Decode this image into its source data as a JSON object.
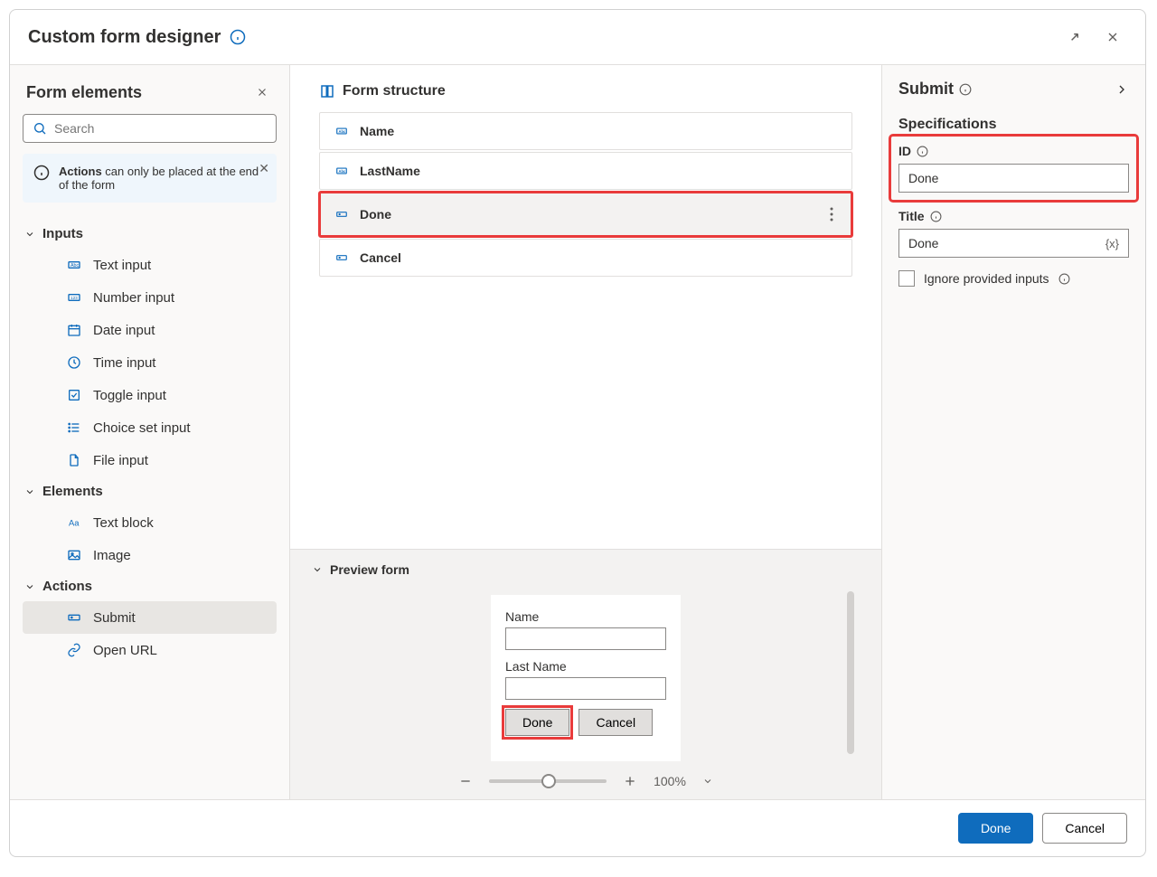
{
  "title": "Custom form designer",
  "left": {
    "heading": "Form elements",
    "search_placeholder": "Search",
    "info_prefix": "Actions",
    "info_text": " can only be placed at the end of the form",
    "groups": {
      "inputs": "Inputs",
      "elements": "Elements",
      "actions": "Actions"
    },
    "items": {
      "text_input": "Text input",
      "number_input": "Number input",
      "date_input": "Date input",
      "time_input": "Time input",
      "toggle_input": "Toggle input",
      "choice_set_input": "Choice set input",
      "file_input": "File input",
      "text_block": "Text block",
      "image": "Image",
      "submit": "Submit",
      "open_url": "Open URL"
    }
  },
  "structure": {
    "heading": "Form structure",
    "rows": {
      "name": "Name",
      "lastname": "LastName",
      "done": "Done",
      "cancel": "Cancel"
    }
  },
  "preview": {
    "heading": "Preview form",
    "labels": {
      "name": "Name",
      "lastname": "Last Name"
    },
    "buttons": {
      "done": "Done",
      "cancel": "Cancel"
    },
    "zoom": "100%"
  },
  "right": {
    "heading": "Submit",
    "spec_heading": "Specifications",
    "id_label": "ID",
    "id_value": "Done",
    "title_label": "Title",
    "title_value": "Done",
    "ignore_label": "Ignore provided inputs"
  },
  "footer": {
    "done": "Done",
    "cancel": "Cancel"
  }
}
